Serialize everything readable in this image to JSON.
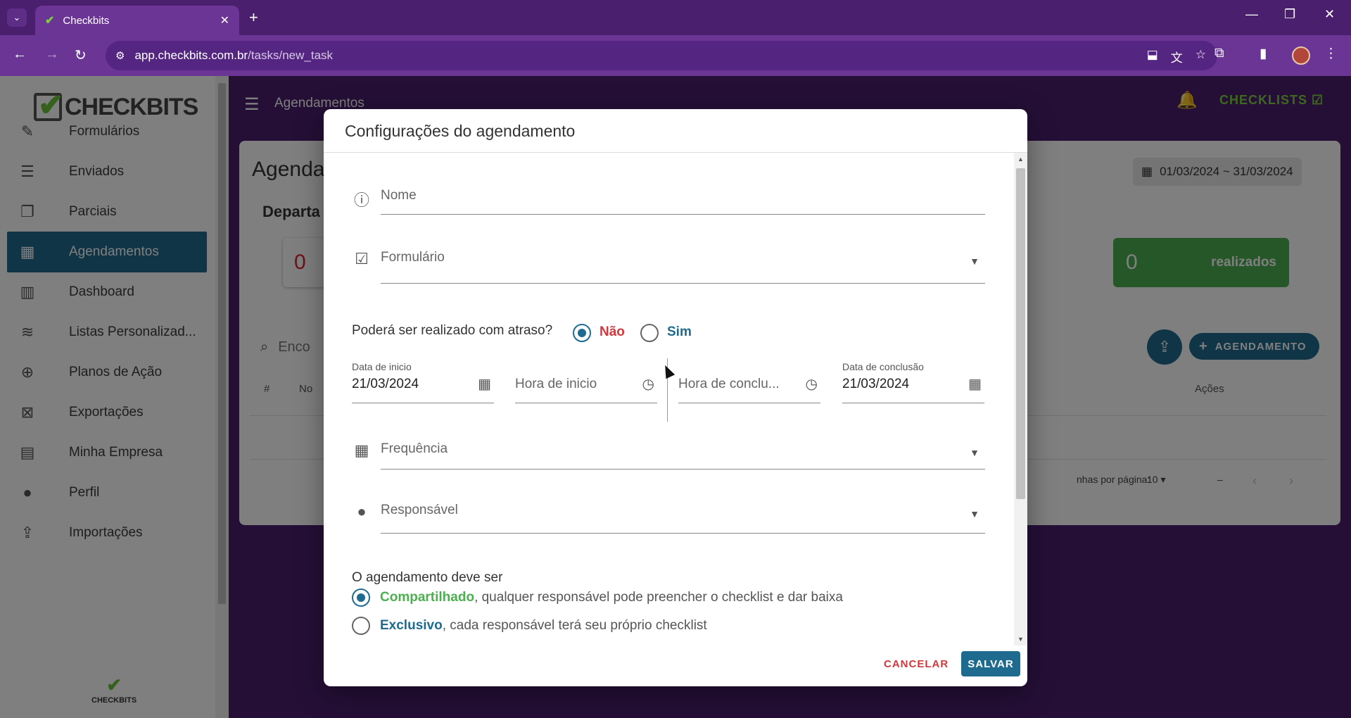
{
  "browser": {
    "tab_title": "Checkbits",
    "url_host": "app.checkbits.com.br",
    "url_path": "/tasks/new_task"
  },
  "sidebar": {
    "logo_text": "CHECKBITS",
    "small_logo_text": "CHECKBITS",
    "items": [
      {
        "label": "Formulários",
        "icon": "form-icon"
      },
      {
        "label": "Enviados",
        "icon": "sent-icon"
      },
      {
        "label": "Parciais",
        "icon": "partial-icon"
      },
      {
        "label": "Agendamentos",
        "icon": "calendar-check-icon",
        "active": true
      },
      {
        "label": "Dashboard",
        "icon": "bar-chart-icon"
      },
      {
        "label": "Listas Personalizad...",
        "icon": "database-icon"
      },
      {
        "label": "Planos de Ação",
        "icon": "target-icon"
      },
      {
        "label": "Exportações",
        "icon": "excel-icon"
      },
      {
        "label": "Minha Empresa",
        "icon": "building-icon"
      },
      {
        "label": "Perfil",
        "icon": "person-icon"
      },
      {
        "label": "Importações",
        "icon": "import-icon"
      }
    ]
  },
  "topbar": {
    "title": "Agendamentos",
    "checklists_label": "CHECKLISTS"
  },
  "background": {
    "card_title": "Agenda",
    "card_subtitle": "Departa",
    "date_range": "01/03/2024 ~ 31/03/2024",
    "stat_left_value": "0",
    "stat_done_value": "0",
    "stat_done_label": "realizados",
    "add_button": "AGENDAMENTO",
    "search_placeholder": "Enco",
    "col_hash": "#",
    "col_name": "No",
    "col_actions": "Ações",
    "rows_per_page_label": "nhas por página:",
    "rows_per_page_value": "10",
    "pagination_range": "–"
  },
  "modal": {
    "title": "Configurações do agendamento",
    "name_placeholder": "Nome",
    "form_placeholder": "Formulário",
    "late_question": "Poderá ser realizado com atraso?",
    "late_no": "Não",
    "late_yes": "Sim",
    "start_date_label": "Data de inicio",
    "start_date_value": "21/03/2024",
    "start_time_placeholder": "Hora de inicio",
    "end_time_placeholder": "Hora de conclu...",
    "end_date_label": "Data de conclusão",
    "end_date_value": "21/03/2024",
    "frequency_placeholder": "Frequência",
    "responsible_placeholder": "Responsável",
    "schedule_type_title": "O agendamento deve ser",
    "shared_bold": "Compartilhado",
    "shared_rest": ", qualquer responsável pode preencher o checklist e dar baixa",
    "exclusive_bold": "Exclusivo",
    "exclusive_rest": ", cada responsável terá seu próprio checklist",
    "cancel": "CANCELAR",
    "save": "SALVAR"
  },
  "colors": {
    "brand_purple": "#4a1f6e",
    "primary_blue": "#1f6b8f",
    "success_green": "#4caf50",
    "danger_red": "#d0393e"
  }
}
